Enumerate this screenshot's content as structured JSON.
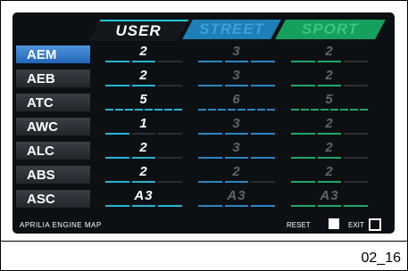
{
  "tabs": [
    "USER",
    "STREET",
    "SPORT"
  ],
  "rows": [
    {
      "label": "AEM",
      "user": "2",
      "street": "3",
      "sport": "2"
    },
    {
      "label": "AEB",
      "user": "2",
      "street": "3",
      "sport": "2"
    },
    {
      "label": "ATC",
      "user": "5",
      "street": "6",
      "sport": "5"
    },
    {
      "label": "AWC",
      "user": "1",
      "street": "3",
      "sport": "2"
    },
    {
      "label": "ALC",
      "user": "2",
      "street": "3",
      "sport": "2"
    },
    {
      "label": "ABS",
      "user": "2",
      "street": "2",
      "sport": "2"
    },
    {
      "label": "ASC",
      "user": "A3",
      "street": "A3",
      "sport": "A3"
    }
  ],
  "footer": {
    "title": "APRILIA ENGINE MAP",
    "reset": "RESET",
    "exit": "EXIT"
  },
  "figure_id": "02_16",
  "colors": {
    "user_accent": "#25b3d8",
    "street_accent": "#1d7fb5",
    "sport_accent": "#15a05e",
    "selected_row": "#2f78c8"
  }
}
